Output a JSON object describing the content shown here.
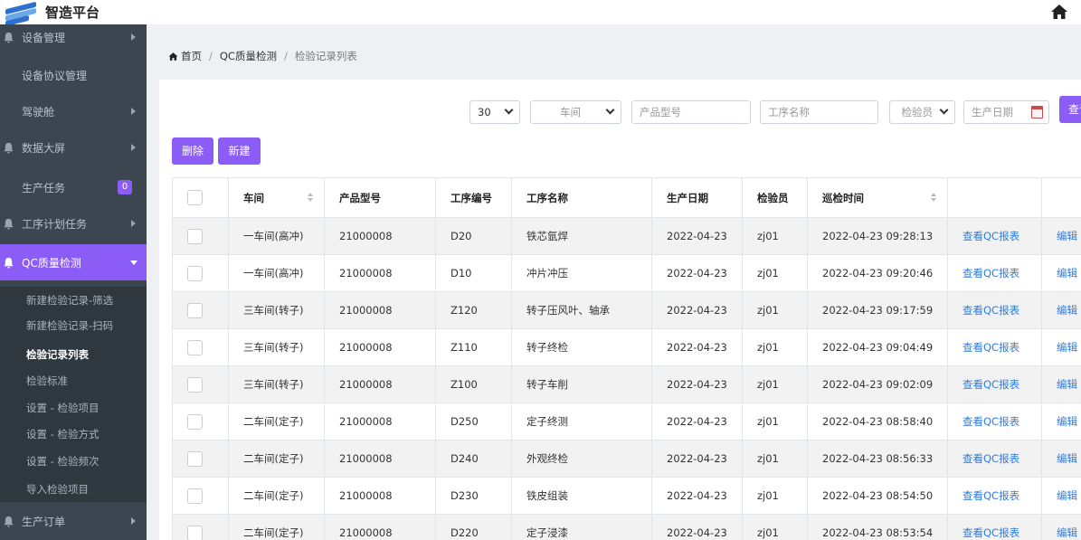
{
  "app": {
    "title": "智造平台"
  },
  "sidebar": {
    "items": [
      {
        "label": "设备管理",
        "bell": true,
        "arrow": true
      },
      {
        "label": "设备协议管理",
        "bell": false,
        "arrow": false
      },
      {
        "label": "驾驶舱",
        "bell": false,
        "arrow": true
      },
      {
        "label": "数据大屏",
        "bell": true,
        "arrow": true
      },
      {
        "label": "生产任务",
        "bell": false,
        "arrow": false,
        "badge": "0"
      },
      {
        "label": "工序计划任务",
        "bell": true,
        "arrow": true
      },
      {
        "label": "QC质量检测",
        "bell": true,
        "active": true
      },
      {
        "label": "生产订单",
        "bell": true,
        "arrow": true
      }
    ],
    "sub_items": [
      {
        "label": "新建检验记录-筛选"
      },
      {
        "label": "新建检验记录-扫码"
      },
      {
        "label": "检验记录列表",
        "current": true
      },
      {
        "label": "检验标准"
      },
      {
        "label": "设置 - 检验项目"
      },
      {
        "label": "设置 - 检验方式"
      },
      {
        "label": "设置 - 检验频次"
      },
      {
        "label": "导入检验项目"
      }
    ]
  },
  "breadcrumb": {
    "home": "首页",
    "section": "QC质量检测",
    "current": "检验记录列表"
  },
  "filters": {
    "page_size": "30",
    "workshop_placeholder": "车间",
    "product_model_placeholder": "产品型号",
    "process_name_placeholder": "工序名称",
    "inspector_placeholder": "检验员",
    "production_date_placeholder": "生产日期",
    "search_label": "查询"
  },
  "actions": {
    "delete_label": "删除",
    "new_label": "新建"
  },
  "table": {
    "headers": [
      "车间",
      "产品型号",
      "工序编号",
      "工序名称",
      "生产日期",
      "检验员",
      "巡检时间",
      "",
      ""
    ],
    "view_label": "查看QC报表",
    "edit_label": "编辑",
    "rows": [
      {
        "workshop": "一车间(高冲)",
        "model": "21000008",
        "code": "D20",
        "name": "铁芯氩焊",
        "date": "2022-04-23",
        "inspector": "zj01",
        "time": "2022-04-23 09:28:13"
      },
      {
        "workshop": "一车间(高冲)",
        "model": "21000008",
        "code": "D10",
        "name": "冲片冲压",
        "date": "2022-04-23",
        "inspector": "zj01",
        "time": "2022-04-23 09:20:46"
      },
      {
        "workshop": "三车间(转子)",
        "model": "21000008",
        "code": "Z120",
        "name": "转子压风叶、轴承",
        "date": "2022-04-23",
        "inspector": "zj01",
        "time": "2022-04-23 09:17:59"
      },
      {
        "workshop": "三车间(转子)",
        "model": "21000008",
        "code": "Z110",
        "name": "转子终检",
        "date": "2022-04-23",
        "inspector": "zj01",
        "time": "2022-04-23 09:04:49"
      },
      {
        "workshop": "三车间(转子)",
        "model": "21000008",
        "code": "Z100",
        "name": "转子车削",
        "date": "2022-04-23",
        "inspector": "zj01",
        "time": "2022-04-23 09:02:09"
      },
      {
        "workshop": "二车间(定子)",
        "model": "21000008",
        "code": "D250",
        "name": "定子终测",
        "date": "2022-04-23",
        "inspector": "zj01",
        "time": "2022-04-23 08:58:40"
      },
      {
        "workshop": "二车间(定子)",
        "model": "21000008",
        "code": "D240",
        "name": "外观终检",
        "date": "2022-04-23",
        "inspector": "zj01",
        "time": "2022-04-23 08:56:33"
      },
      {
        "workshop": "二车间(定子)",
        "model": "21000008",
        "code": "D230",
        "name": "铁皮组装",
        "date": "2022-04-23",
        "inspector": "zj01",
        "time": "2022-04-23 08:54:50"
      },
      {
        "workshop": "二车间(定子)",
        "model": "21000008",
        "code": "D220",
        "name": "定子浸漆",
        "date": "2022-04-23",
        "inspector": "zj01",
        "time": "2022-04-23 08:53:54"
      }
    ]
  },
  "colors": {
    "accent": "#8b5cf6",
    "sidebar_bg": "#3c4650",
    "submenu_bg": "#2f373f",
    "link": "#2d7be0",
    "row_stripe": "#f2f2f2"
  }
}
